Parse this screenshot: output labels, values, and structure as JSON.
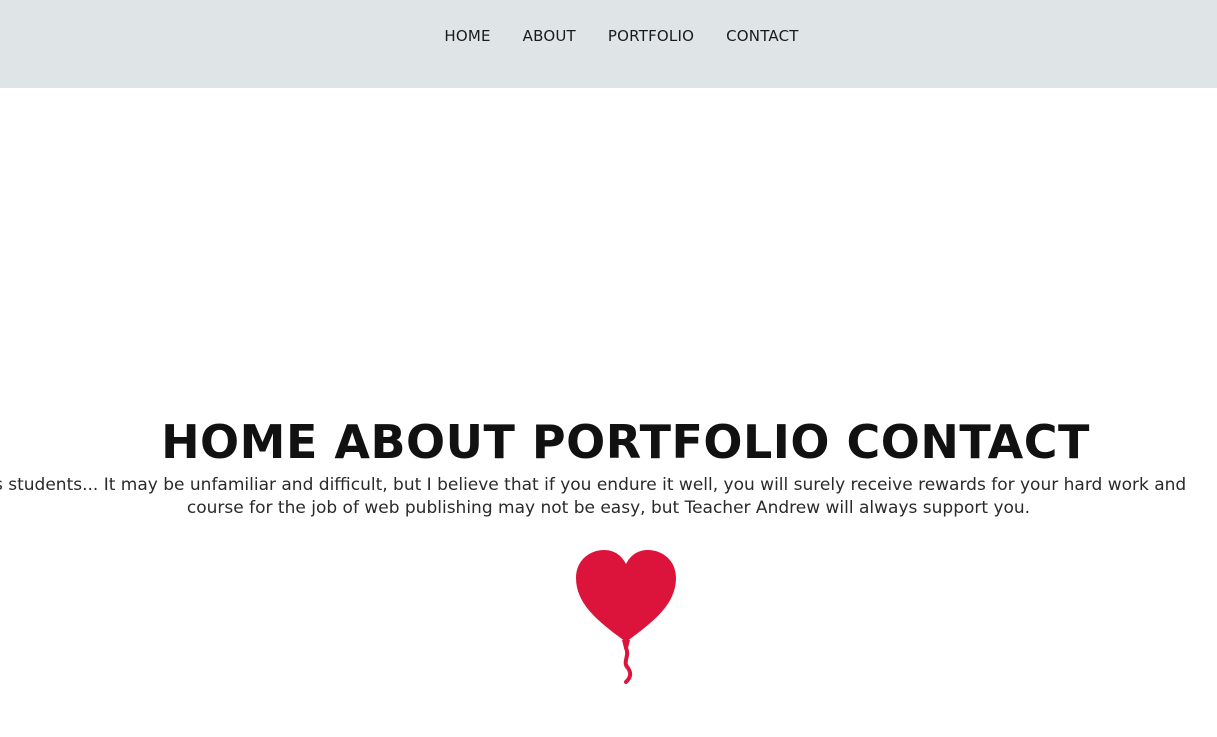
{
  "nav": {
    "items": [
      {
        "label": "HOME"
      },
      {
        "label": "ABOUT"
      },
      {
        "label": "PORTFOLIO"
      },
      {
        "label": "CONTACT"
      }
    ]
  },
  "hero": {
    "title": "HOME ABOUT PORTFOLIO CONTACT",
    "line1": "s students... It may be unfamiliar and difficult, but I believe that if you endure it well, you will surely receive rewards for your hard work and",
    "line2": "course for the job of web publishing may not be easy, but Teacher Andrew will always support you."
  },
  "colors": {
    "nav_bg": "#dfe5e7",
    "balloon": "#dc143c"
  },
  "icons": {
    "balloon": "heart-balloon-icon"
  }
}
